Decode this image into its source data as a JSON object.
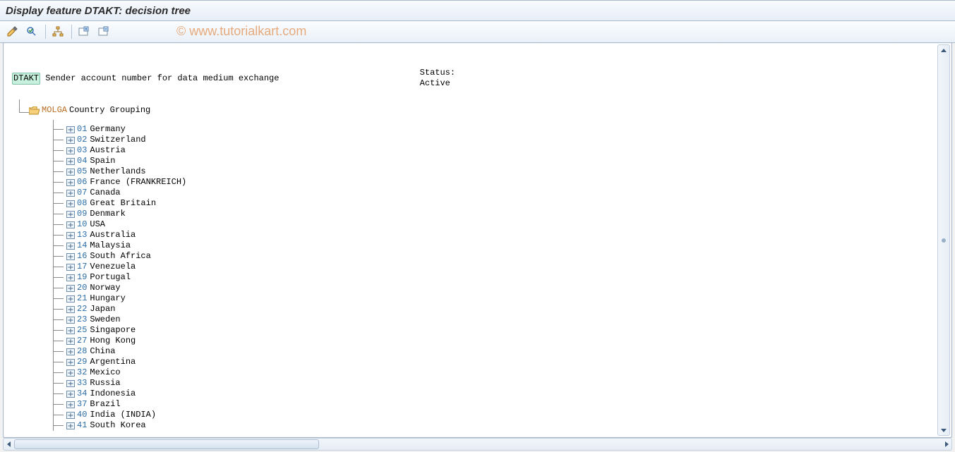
{
  "title": "Display feature DTAKT: decision tree",
  "watermark": "© www.tutorialkart.com",
  "toolbar_icons": {
    "edit": "edit-pencil-icon",
    "check": "check-magnifier-icon",
    "hierarchy": "hierarchy-icon",
    "expand": "expand-node-icon",
    "collapse": "collapse-node-icon"
  },
  "root": {
    "key": "DTAKT",
    "desc": "Sender account number for data medium exchange",
    "status_label": "Status:",
    "status_value": "Active"
  },
  "grouping": {
    "key": "MOLGA",
    "desc": "Country Grouping"
  },
  "countries": [
    {
      "code": "01",
      "label": "Germany"
    },
    {
      "code": "02",
      "label": "Switzerland"
    },
    {
      "code": "03",
      "label": "Austria"
    },
    {
      "code": "04",
      "label": "Spain"
    },
    {
      "code": "05",
      "label": "Netherlands"
    },
    {
      "code": "06",
      "label": "France (FRANKREICH)"
    },
    {
      "code": "07",
      "label": "Canada"
    },
    {
      "code": "08",
      "label": "Great Britain"
    },
    {
      "code": "09",
      "label": "Denmark"
    },
    {
      "code": "10",
      "label": "USA"
    },
    {
      "code": "13",
      "label": "Australia"
    },
    {
      "code": "14",
      "label": "Malaysia"
    },
    {
      "code": "16",
      "label": "South Africa"
    },
    {
      "code": "17",
      "label": "Venezuela"
    },
    {
      "code": "19",
      "label": "Portugal"
    },
    {
      "code": "20",
      "label": "Norway"
    },
    {
      "code": "21",
      "label": "Hungary"
    },
    {
      "code": "22",
      "label": "Japan"
    },
    {
      "code": "23",
      "label": "Sweden"
    },
    {
      "code": "25",
      "label": "Singapore"
    },
    {
      "code": "27",
      "label": "Hong Kong"
    },
    {
      "code": "28",
      "label": "China"
    },
    {
      "code": "29",
      "label": "Argentina"
    },
    {
      "code": "32",
      "label": "Mexico"
    },
    {
      "code": "33",
      "label": "Russia"
    },
    {
      "code": "34",
      "label": "Indonesia"
    },
    {
      "code": "37",
      "label": "Brazil"
    },
    {
      "code": "40",
      "label": "India (INDIA)"
    },
    {
      "code": "41",
      "label": "South Korea"
    }
  ]
}
